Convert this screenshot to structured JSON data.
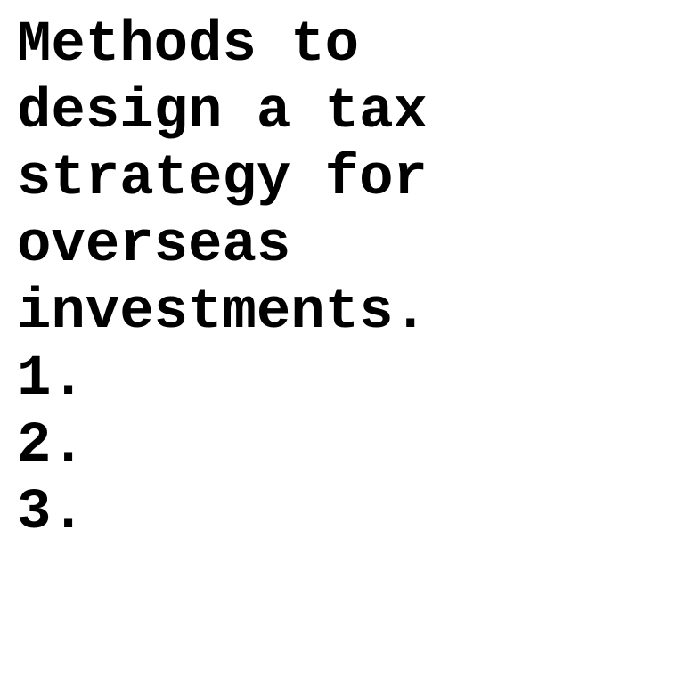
{
  "document": {
    "title_lines": [
      "Methods to",
      "design a tax",
      "strategy for",
      "overseas",
      "investments."
    ],
    "items": [
      "1.",
      "2.",
      "3."
    ]
  },
  "colors": {
    "background": "#ffffff",
    "text": "#000000"
  }
}
